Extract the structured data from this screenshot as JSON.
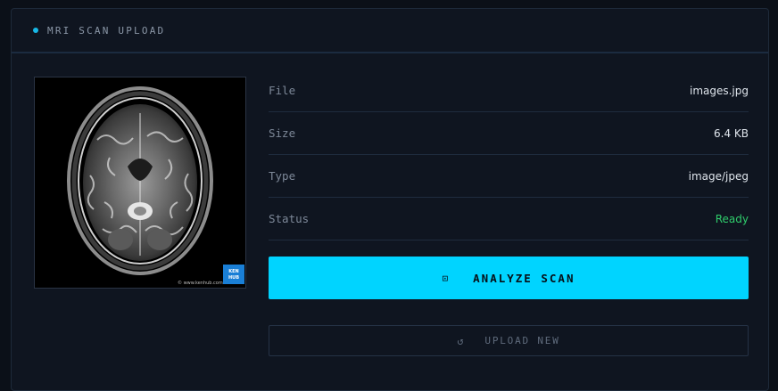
{
  "header": {
    "title": "MRI SCAN UPLOAD",
    "accent": "#17b8e6"
  },
  "preview": {
    "watermark": "© www.kenhub.com",
    "logo": "KEN HUB"
  },
  "details": [
    {
      "label": "File",
      "value": "images.jpg"
    },
    {
      "label": "Size",
      "value": "6.4 KB"
    },
    {
      "label": "Type",
      "value": "image/jpeg"
    },
    {
      "label": "Status",
      "value": "Ready",
      "status_color": "#2fcc6b"
    }
  ],
  "actions": {
    "analyze": {
      "icon": "scan-icon",
      "icon_glyph": "⊡",
      "label": "ANALYZE SCAN",
      "color": "#00d4ff"
    },
    "upload_new": {
      "icon": "refresh-icon",
      "icon_glyph": "↺",
      "label": "UPLOAD NEW"
    }
  }
}
